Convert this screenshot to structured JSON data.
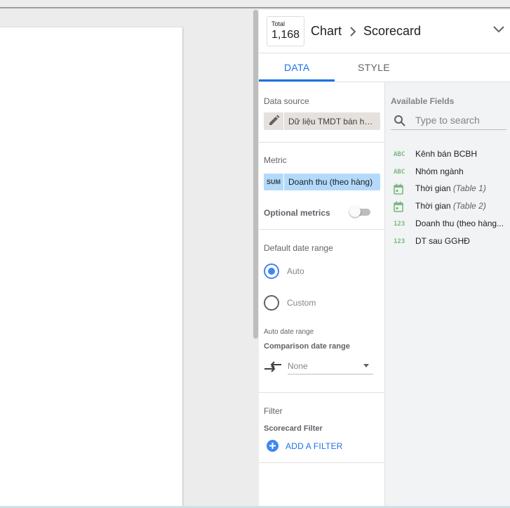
{
  "header": {
    "total_label": "Total",
    "total_value": "1,168",
    "breadcrumb_root": "Chart",
    "breadcrumb_separator": ">",
    "breadcrumb_current": "Scorecard"
  },
  "tabs": [
    {
      "label": "DATA",
      "active": true
    },
    {
      "label": "STYLE",
      "active": false
    }
  ],
  "data_source": {
    "title": "Data source",
    "value": "Dữ liệu TMDT bán hàng"
  },
  "metric": {
    "title": "Metric",
    "aggregation": "SUM",
    "value": "Doanh thu (theo hàng)"
  },
  "optional_metrics": {
    "label": "Optional metrics",
    "enabled": false
  },
  "date_range": {
    "title": "Default date range",
    "options": [
      "Auto",
      "Custom"
    ],
    "selected": "Auto",
    "sublabel": "Auto date range",
    "comparison_label": "Comparison date range",
    "comparison_value": "None"
  },
  "filter": {
    "title": "Filter",
    "sublabel": "Scorecard Filter",
    "add_label": "ADD A FILTER"
  },
  "available_fields": {
    "title": "Available Fields",
    "search_placeholder": "Type to search",
    "items": [
      {
        "type": "ABC",
        "label": "Kênh bán BCBH",
        "suffix": ""
      },
      {
        "type": "ABC",
        "label": "Nhóm ngành",
        "suffix": ""
      },
      {
        "type": "date",
        "label": "Thời gian ",
        "suffix": "(Table 1)"
      },
      {
        "type": "date",
        "label": "Thời gian ",
        "suffix": "(Table 2)"
      },
      {
        "type": "123",
        "label": "Doanh thu (theo hàng...",
        "suffix": ""
      },
      {
        "type": "123",
        "label": "DT sau GGHĐ",
        "suffix": ""
      }
    ]
  },
  "colors": {
    "accent": "#1a73e8",
    "metric_chip": "#b3dafb",
    "datasource_chip": "#e6e1dd",
    "field_icon": "#7cb87f"
  }
}
